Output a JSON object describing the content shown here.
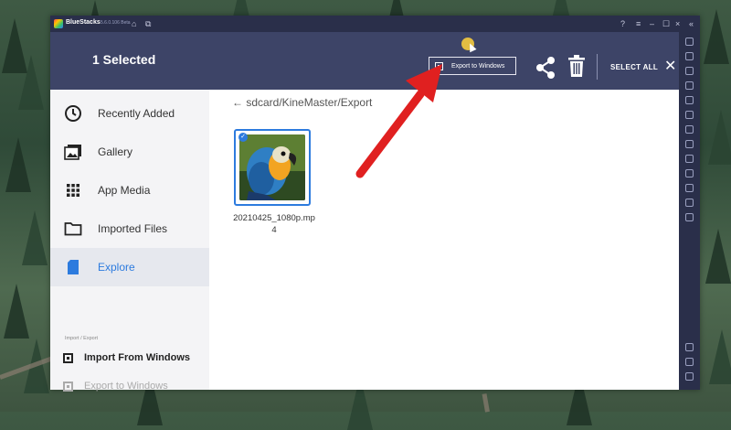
{
  "titlebar": {
    "title": "BlueStacks",
    "version": "5.6.0.106 Beta"
  },
  "appbar": {
    "selected_count": "1 Selected",
    "export_button": "Export to Windows",
    "select_all": "SELECT ALL"
  },
  "sidebar": {
    "items": [
      {
        "label": "Recently Added",
        "icon": "clock-icon"
      },
      {
        "label": "Gallery",
        "icon": "gallery-icon"
      },
      {
        "label": "App Media",
        "icon": "grid-icon"
      },
      {
        "label": "Imported Files",
        "icon": "folder-icon"
      },
      {
        "label": "Explore",
        "icon": "sdcard-icon",
        "active": true
      }
    ],
    "section_title": "Import / Export",
    "import_label": "Import From Windows",
    "export_label": "Export to Windows"
  },
  "content": {
    "breadcrumb": "← sdcard/KineMaster/Export",
    "files": [
      {
        "name": "20210425_1080p.mp4",
        "selected": true
      }
    ]
  },
  "colors": {
    "appbar": "#3d4467",
    "titlebar": "#2a2f4a",
    "accent": "#2d7bde",
    "annotation_arrow": "#e02020"
  }
}
